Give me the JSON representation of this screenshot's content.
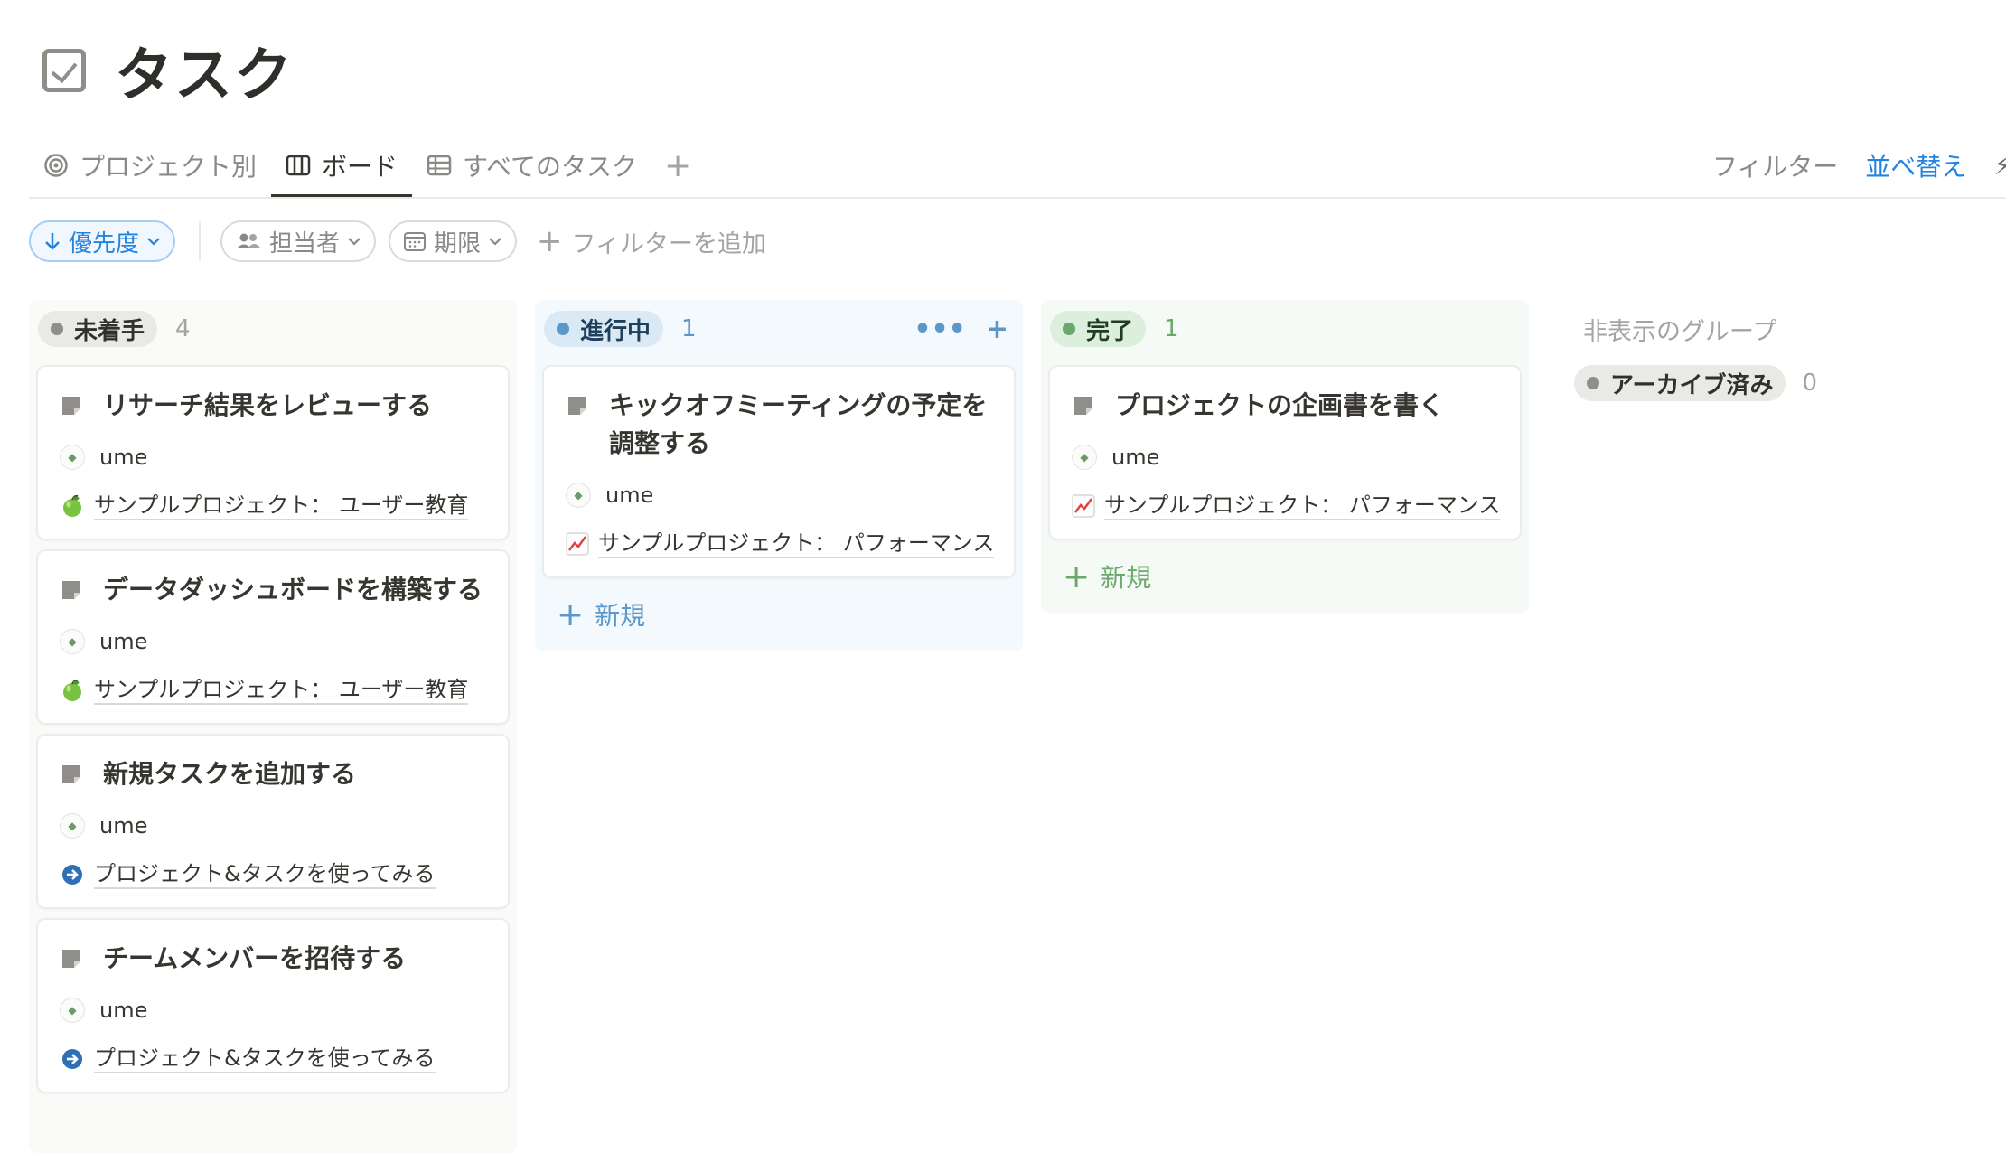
{
  "page": {
    "title": "タスク",
    "icon": "checkbox-icon"
  },
  "tabs": [
    {
      "label": "プロジェクト別",
      "icon": "target-icon",
      "active": false
    },
    {
      "label": "ボード",
      "icon": "board-icon",
      "active": true
    },
    {
      "label": "すべてのタスク",
      "icon": "table-icon",
      "active": false
    }
  ],
  "tab_add": "+",
  "actions": {
    "filter": "フィルター",
    "sort": "並べ替え",
    "bolt": "⚡"
  },
  "filters": {
    "sort_chip": "優先度",
    "assignee_chip": "担当者",
    "due_chip": "期限",
    "add_filter": "フィルターを追加"
  },
  "columns": {
    "todo": {
      "label": "未着手",
      "count": "4",
      "cards": [
        {
          "title": "リサーチ結果をレビューする",
          "assignee": "ume",
          "project": "サンプルプロジェクト： ユーザー教育",
          "project_icon": "apple-icon"
        },
        {
          "title": "データダッシュボードを構築する",
          "assignee": "ume",
          "project": "サンプルプロジェクト： ユーザー教育",
          "project_icon": "apple-icon"
        },
        {
          "title": "新規タスクを追加する",
          "assignee": "ume",
          "project": "プロジェクト&タスクを使ってみる",
          "project_icon": "arrow-circle-icon"
        },
        {
          "title": "チームメンバーを招待する",
          "assignee": "ume",
          "project": "プロジェクト&タスクを使ってみる",
          "project_icon": "arrow-circle-icon"
        }
      ]
    },
    "doing": {
      "label": "進行中",
      "count": "1",
      "tools": {
        "more": "•••",
        "add": "+"
      },
      "cards": [
        {
          "title": "キックオフミーティングの予定を調整する",
          "assignee": "ume",
          "project": "サンプルプロジェクト： パフォーマンス",
          "project_icon": "chart-up-icon"
        }
      ],
      "new_label": "新規"
    },
    "done": {
      "label": "完了",
      "count": "1",
      "cards": [
        {
          "title": "プロジェクトの企画書を書く",
          "assignee": "ume",
          "project": "サンプルプロジェクト： パフォーマンス",
          "project_icon": "chart-up-icon"
        }
      ],
      "new_label": "新規"
    }
  },
  "hidden_groups": {
    "title": "非表示のグループ",
    "items": [
      {
        "label": "アーカイブ済み",
        "count": "0"
      }
    ]
  },
  "colors": {
    "accent": "#2383e2",
    "doing": "#5b97c9",
    "done": "#6aa96b",
    "todo": "#8f8e8a"
  }
}
